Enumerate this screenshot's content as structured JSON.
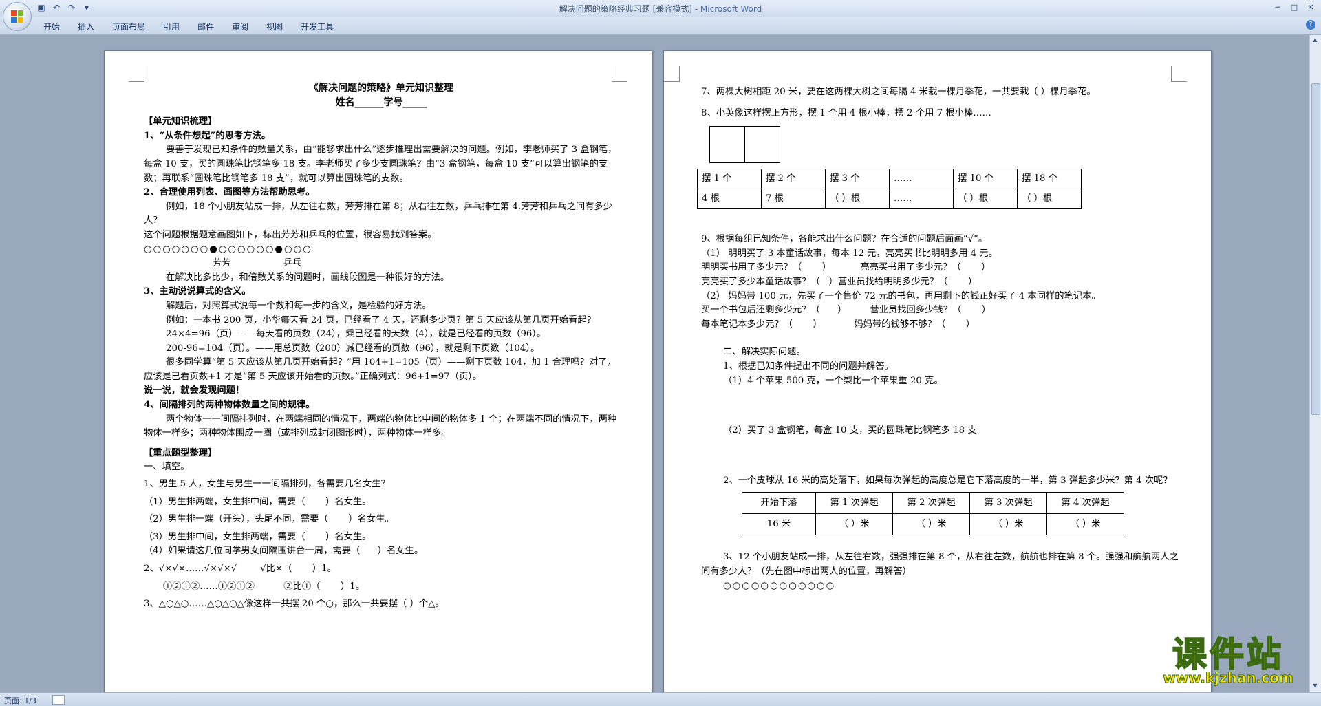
{
  "window": {
    "title": "解决问题的策略经典习题 [兼容模式] - ",
    "app": "Microsoft Word"
  },
  "ribbon": {
    "tabs": [
      "开始",
      "插入",
      "页面布局",
      "引用",
      "邮件",
      "审阅",
      "视图",
      "开发工具"
    ],
    "help": "?"
  },
  "status": {
    "page": "页面: 1/3"
  },
  "page1": {
    "title": "《解决问题的策略》单元知识整理",
    "subtitle": "姓名______学号_____",
    "sec1": "【单元知识梳理】",
    "h1": "1、“从条件想起”的思考方法。",
    "p1": "要善于发现已知条件的数量关系，由“能够求出什么”逐步推理出需要解决的问题。例如，李老师买了 3 盒钢笔，每盒 10 支，买的圆珠笔比钢笔多 18 支。李老师买了多少支圆珠笔？由“3 盒钢笔，每盒 10 支”可以算出钢笔的支数；再联系“圆珠笔比钢笔多 18 支”，就可以算出圆珠笔的支数。",
    "h2": "2、合理使用列表、画图等方法帮助思考。",
    "p2": "例如，18 个小朋友站成一排，从左往右数，芳芳排在第 8；从右往左数，乒乓排在第 4.芳芳和乒乓之间有多少人？",
    "p3": "这个问题根据题意画图如下，标出芳芳和乒乓的位置，很容易找到答案。",
    "circles": "○○○○○○○●○○○○○○●○○○",
    "names": "芳芳                  乒乓",
    "p4": "在解决比多比少，和倍数关系的问题时，画线段图是一种很好的方法。",
    "h3": "3、主动说说算式的含义。",
    "p5": "解题后，对照算式说每一个数和每一步的含义，是检验的好方法。",
    "p6": "例如：一本书 200 页，小华每天看 24 页，已经看了 4 天，还剩多少页？第 5 天应该从第几页开始看起？",
    "p7": "24×4=96（页）——每天看的页数（24），乘已经看的天数（4），就是已经看的页数（96）。",
    "p8": "200-96=104（页）。——用总页数（200）减已经看的页数（96），就是剩下页数（104）。",
    "p9": "很多同学算“第 5 天应该从第几页开始看起？”用 104+1=105（页）——剩下页数 104，加 1 合理吗？对了，应该是已看页数+1 才是“第 5 天应该开始看的页数。”正确列式：96+1=97（页）。",
    "p10": "说一说，就会发现问题！",
    "h4": "4、间隔排列的两种物体数量之间的规律。",
    "p11": "两个物体一一间隔排列时，在两端相同的情况下，两端的物体比中间的物体多 1 个；在两端不同的情况下，两种物体一样多；两种物体围成一圈（或排列成封闭图形时），两种物体一样多。",
    "sec2": "【重点题型整理】",
    "s1": "一、填空。",
    "q1": "1、男生 5 人，女生与男生一一间隔排列，各需要几名女生？",
    "q1a": "（1）男生排两端，女生排中间，需要（       ）名女生。",
    "q1b": "（2）男生排一端（开头），头尾不同，需要（       ）名女生。",
    "q1c": "（3）男生排中间，女生排两端，需要（       ）名女生。",
    "q1d": "（4）如果请这几位同学男女间隔围讲台一周，需要（      ）名女生。",
    "q2": "2、√×√×……√×√×√        √比×（       ）1。",
    "q2b": "①②①②……①②①②          ②比①（       ）1。",
    "q3": "3、△○△○……△○△○△像这样一共摆 20 个○，那么一共要摆（  ）个△。"
  },
  "page2": {
    "q7": "7、两棵大树相距 20 米，要在这两棵大树之间每隔 4 米栽一棵月季花，一共要栽（      ）棵月季花。",
    "q8": "8、小英像这样摆正方形，摆 1 个用 4 根小棒，摆 2 个用 7 根小棒……",
    "table1": {
      "row1": [
        "摆 1 个",
        "摆 2 个",
        "摆 3 个",
        "……",
        "摆 10 个",
        "摆 18 个"
      ],
      "row2": [
        "4 根",
        "7 根",
        "（   ）根",
        "……",
        "（   ）根",
        "（   ）根"
      ]
    },
    "q9": "9、根据每组已知条件，各能求出什么问题？在合适的问题后面画“√”。",
    "q9a": "（1）  明明买了 3 本童话故事，每本 12 元，亮亮买书比明明多用 4 元。",
    "q9a1": "明明买书用了多少元？（       ）          亮亮买书用了多少元？（       ）",
    "q9a2": "亮亮买了多少本童话故事？（   ）营业员找给明明多少元？（       ）",
    "q9b": "（2）  妈妈带 100 元，先买了一个售价 72 元的书包，再用剩下的钱正好买了 4 本同样的笔记本。",
    "q9b1": "买一个书包后还剩多少元？（      ）        营业员找回多少钱？（       ）",
    "q9b2": "每本笔记本多少元？（       ）           妈妈带的钱够不够？（       ）",
    "s2": "二、解决实际问题。",
    "r1": "1、根据已知条件提出不同的问题并解答。",
    "r1a": "（1）4 个苹果 500 克，一个梨比一个苹果重 20 克。",
    "r1b": "（2）买了 3 盒钢笔，每盒 10 支，买的圆珠笔比钢笔多 18 支",
    "r2": "2、一个皮球从 16 米的高处落下，如果每次弹起的高度总是它下落高度的一半，第 3 弹起多少米？第 4 次呢？",
    "table2": {
      "row1": [
        "开始下落",
        "第 1 次弹起",
        "第 2 次弹起",
        "第 3 次弹起",
        "第 4 次弹起"
      ],
      "row2": [
        "16 米",
        "（ ）米",
        "（ ）米",
        "（ ）米",
        "（ ）米"
      ]
    },
    "r3": "3、12 个小朋友站成一排，从左往右数，强强排在第 8 个，从右往左数，航航也排在第 8 个。强强和航航两人之间有多少人？（先在图中标出两人的位置，再解答）",
    "circles": "○○○○○○○○○○○○"
  },
  "watermark": {
    "cn": "课件站",
    "url": "www.kjzhan.com"
  }
}
